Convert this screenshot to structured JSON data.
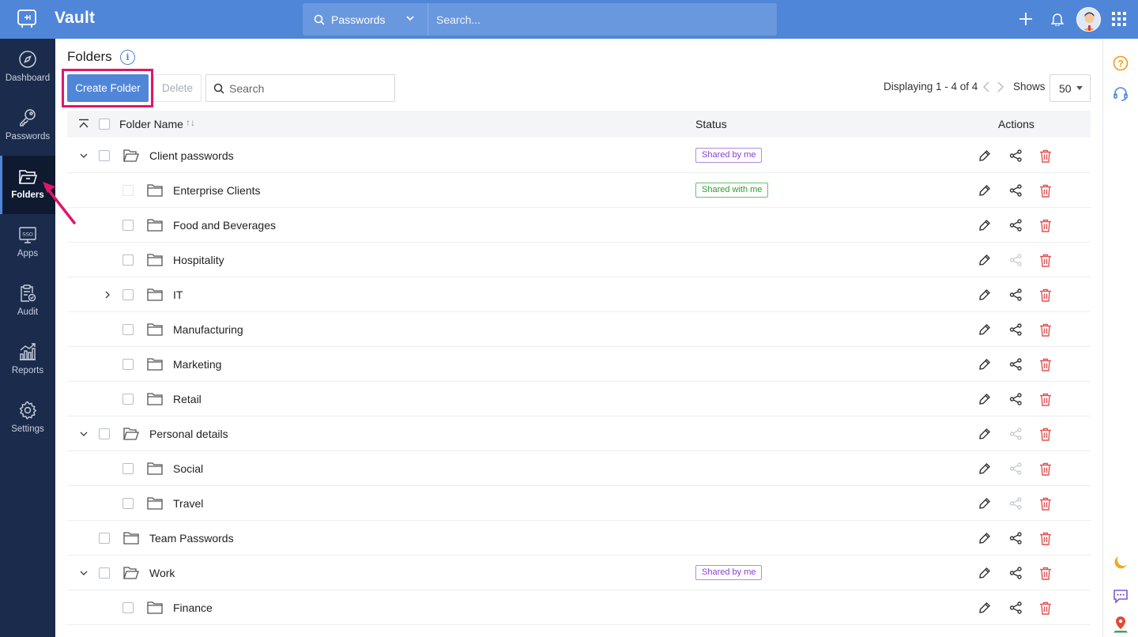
{
  "app": {
    "title": "Vault",
    "search_scope": "Passwords",
    "search_placeholder": "Search..."
  },
  "sidebar": {
    "items": [
      {
        "label": "Dashboard",
        "icon": "compass-icon"
      },
      {
        "label": "Passwords",
        "icon": "key-icon"
      },
      {
        "label": "Folders",
        "icon": "folder-icon",
        "active": true
      },
      {
        "label": "Apps",
        "icon": "sso-icon"
      },
      {
        "label": "Audit",
        "icon": "audit-icon"
      },
      {
        "label": "Reports",
        "icon": "reports-icon"
      },
      {
        "label": "Settings",
        "icon": "gear-icon"
      }
    ]
  },
  "page": {
    "title": "Folders",
    "create_label": "Create Folder",
    "delete_label": "Delete",
    "search_placeholder": "Search",
    "pager_text": "Displaying 1 - 4 of 4",
    "shows_label": "Shows",
    "shows_value": "50"
  },
  "table": {
    "col_name": "Folder Name",
    "col_status": "Status",
    "col_actions": "Actions",
    "rows": [
      {
        "name": "Client passwords",
        "level": 0,
        "expander": "down",
        "status": "Shared by me",
        "status_type": "by",
        "share_enabled": true,
        "checkbox_disabled": false
      },
      {
        "name": "Enterprise Clients",
        "level": 1,
        "expander": "",
        "status": "Shared with me",
        "status_type": "with",
        "share_enabled": true,
        "checkbox_disabled": true
      },
      {
        "name": "Food and Beverages",
        "level": 1,
        "expander": "",
        "status": "",
        "status_type": "",
        "share_enabled": true,
        "checkbox_disabled": false
      },
      {
        "name": "Hospitality",
        "level": 1,
        "expander": "",
        "status": "",
        "status_type": "",
        "share_enabled": false,
        "checkbox_disabled": false
      },
      {
        "name": "IT",
        "level": 1,
        "expander": "right",
        "status": "",
        "status_type": "",
        "share_enabled": true,
        "checkbox_disabled": false
      },
      {
        "name": "Manufacturing",
        "level": 1,
        "expander": "",
        "status": "",
        "status_type": "",
        "share_enabled": true,
        "checkbox_disabled": false
      },
      {
        "name": "Marketing",
        "level": 1,
        "expander": "",
        "status": "",
        "status_type": "",
        "share_enabled": true,
        "checkbox_disabled": false
      },
      {
        "name": "Retail",
        "level": 1,
        "expander": "",
        "status": "",
        "status_type": "",
        "share_enabled": true,
        "checkbox_disabled": false
      },
      {
        "name": "Personal details",
        "level": 0,
        "expander": "down",
        "status": "",
        "status_type": "",
        "share_enabled": false,
        "checkbox_disabled": false
      },
      {
        "name": "Social",
        "level": 1,
        "expander": "",
        "status": "",
        "status_type": "",
        "share_enabled": false,
        "checkbox_disabled": false
      },
      {
        "name": "Travel",
        "level": 1,
        "expander": "",
        "status": "",
        "status_type": "",
        "share_enabled": false,
        "checkbox_disabled": false
      },
      {
        "name": "Team Passwords",
        "level": 0,
        "expander": "",
        "status": "",
        "status_type": "",
        "share_enabled": true,
        "checkbox_disabled": false
      },
      {
        "name": "Work",
        "level": 0,
        "expander": "down",
        "status": "Shared by me",
        "status_type": "by",
        "share_enabled": true,
        "checkbox_disabled": false
      },
      {
        "name": "Finance",
        "level": 1,
        "expander": "",
        "status": "",
        "status_type": "",
        "share_enabled": true,
        "checkbox_disabled": false
      }
    ]
  },
  "colors": {
    "brand": "#4f86d8",
    "sidebar": "#1b2b4b",
    "highlight": "#e0166c",
    "delete_icon": "#e05252",
    "shared_by_me": "#8a3fd1",
    "shared_with_me": "#2f9a2f"
  }
}
